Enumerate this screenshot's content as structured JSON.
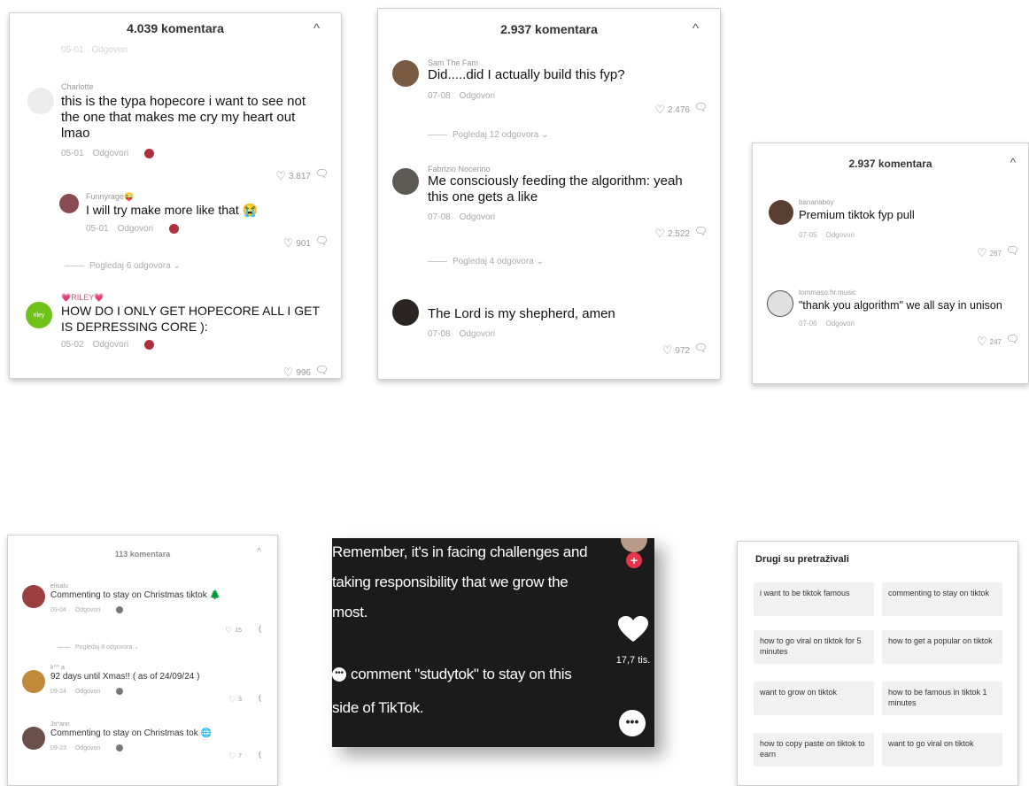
{
  "panel1": {
    "title": "4.039 komentara",
    "close": "^",
    "partial_meta": "05-01 · Odgovori",
    "comments": [
      {
        "user": "Charlotte",
        "text": "this is the typa hopecore i want to see not the one that makes me cry my heart out lmao",
        "date": "05-01",
        "reply": "Odgovori",
        "likes": "3.817"
      },
      {
        "user": "Funnyrage😜",
        "text": "I will try make more like that 😭",
        "date": "05-01",
        "reply": "Odgovori",
        "likes": "901"
      },
      {
        "user": "💗RILEY💗",
        "text": "HOW DO I ONLY GET HOPECORE ALL I GET IS DEPRESSING CORE ):",
        "date": "05-02",
        "reply": "Odgovori",
        "likes": "996",
        "avatar_text": "riley"
      }
    ],
    "view_replies": "Pogledaj 6 odgovora ⌄"
  },
  "panel2": {
    "title": "2.937 komentara",
    "close": "^",
    "comments": [
      {
        "user": "Sam The Fam",
        "text": "Did.....did I actually build this fyp?",
        "date": "07-08",
        "reply": "Odgovori",
        "likes": "2.476"
      },
      {
        "user": "Fabrizio Nocerino",
        "text": "Me consciously feeding the algorithm: yeah this one gets a like",
        "date": "07-08",
        "reply": "Odgovori",
        "likes": "2.522"
      },
      {
        "user": "",
        "text": "The Lord is my shepherd, amen",
        "date": "07-08",
        "reply": "Odgovori",
        "likes": "972"
      }
    ],
    "view_replies_1": "Pogledaj 12 odgovora ⌄",
    "view_replies_2": "Pogledaj 4 odgovora ⌄"
  },
  "panel3": {
    "title": "2.937 komentara",
    "close": "^",
    "comments": [
      {
        "user": "bananaboy",
        "text": "Premium tiktok fyp pull",
        "date": "07-05",
        "reply": "Odgovori",
        "likes": "267"
      },
      {
        "user": "tommaso.hr.music",
        "text": "\"thank you algorithm\" we all say in unison",
        "date": "07-06",
        "reply": "Odgovori",
        "likes": "247"
      }
    ]
  },
  "panel4": {
    "title": "113 komentara",
    "close": "^",
    "comments": [
      {
        "user": "elisalu",
        "text": "Commenting to stay on Christmas tiktok 🌲",
        "date": "09-04",
        "reply": "Odgovori",
        "likes": "15"
      },
      {
        "user": "k^^ a",
        "text": "92 days until Xmas!! ( as of 24/09/24 )",
        "date": "09-24",
        "reply": "Odgovori",
        "likes": "3"
      },
      {
        "user": "Jo*ann",
        "text": "Commenting to stay on Christmas tok 🌐",
        "date": "09-23",
        "reply": "Odgovori",
        "likes": "7"
      }
    ],
    "view_replies": "Pogledaj 8 odgovora ⌄"
  },
  "video": {
    "caption_lines": [
      "Remember, it's in facing challenges and",
      "taking responsibility that we grow the",
      "most."
    ],
    "comment_line_1": "comment \"studytok\" to stay on this",
    "comment_line_2": "side of TikTok.",
    "like_count": "17,7 tis.",
    "plus": "+"
  },
  "searches": {
    "title": "Drugi su pretraživali",
    "items": [
      "i want to be tiktok famous",
      "commenting to stay on tiktok",
      "how to go viral on tiktok for 5 minutes",
      "how to get a popular on tiktok",
      "want to grow on tiktok",
      "how to be famous in tiktok 1 minutes",
      "how to copy paste on tiktok to earn",
      "want to go viral on tiktok"
    ]
  },
  "colors": {
    "reaction": "#b0303c",
    "riley_avatar": "#6fc21a",
    "tiktok_red": "#e8334a"
  }
}
